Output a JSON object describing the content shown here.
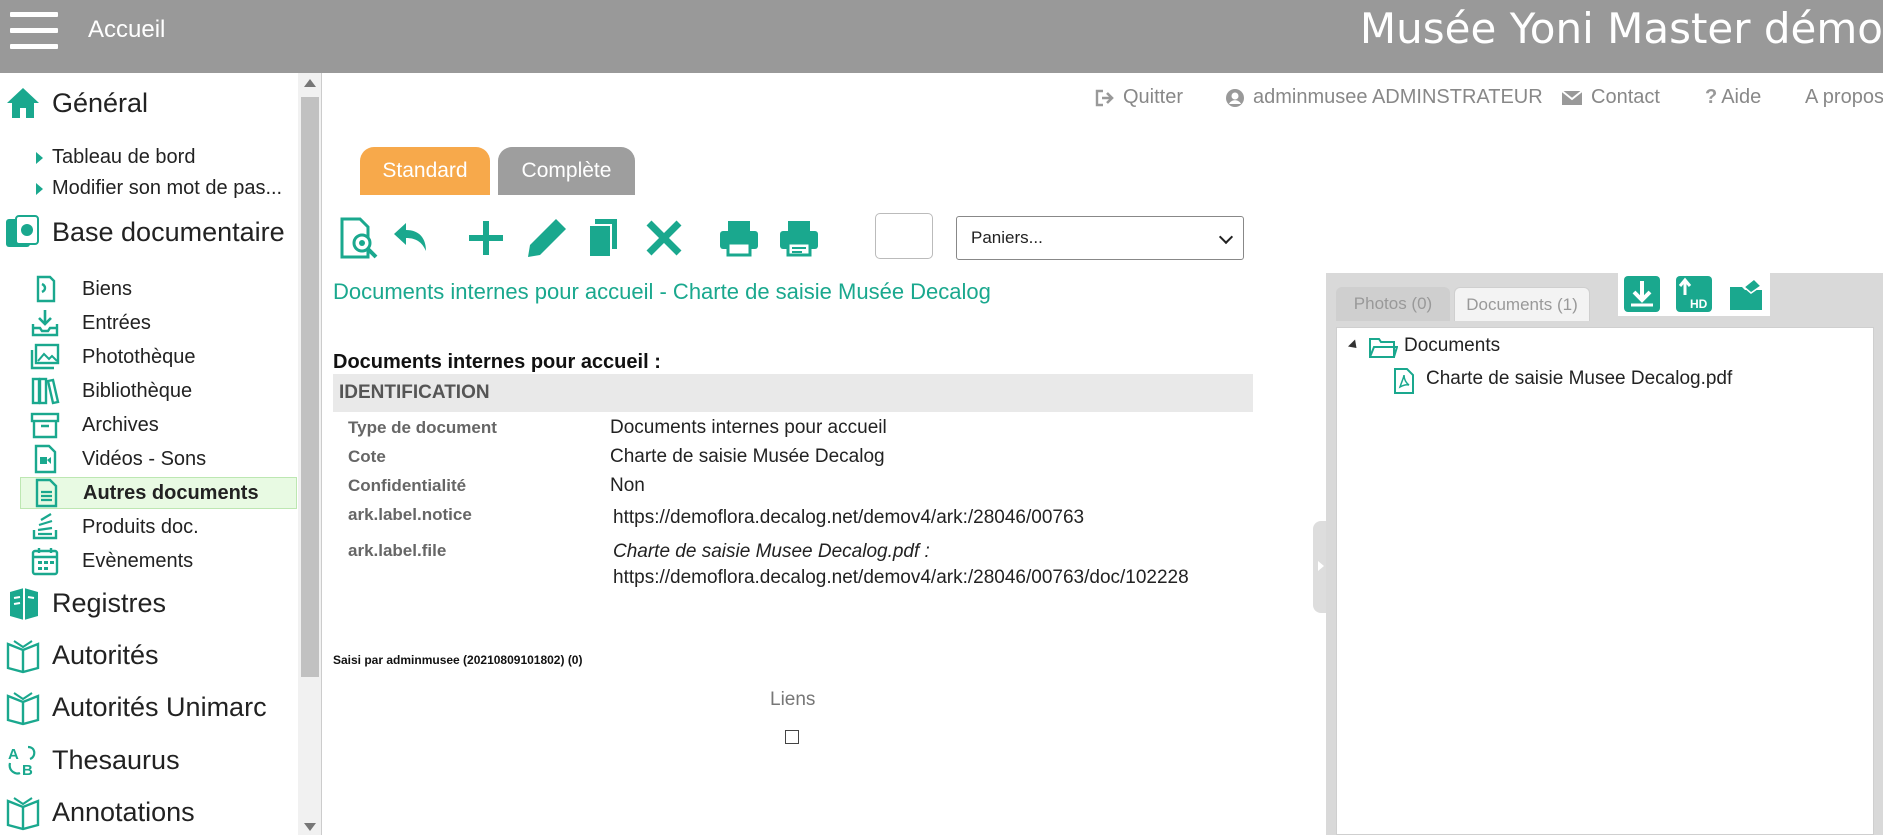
{
  "header": {
    "home_label": "Accueil",
    "site_title": "Musée Yoni Master démo"
  },
  "sidebar": {
    "general": "Général",
    "general_items": [
      "Tableau de bord",
      "Modifier son mot de pas..."
    ],
    "base_documentaire": "Base documentaire",
    "doc_items": [
      "Biens",
      "Entrées",
      "Photothèque",
      "Bibliothèque",
      "Archives",
      "Vidéos - Sons",
      "Autres documents",
      "Produits doc.",
      "Evènements"
    ],
    "active_item": "Autres documents",
    "registres": "Registres",
    "autorites": "Autorités",
    "autorites_unimarc": "Autorités Unimarc",
    "thesaurus": "Thesaurus",
    "annotations": "Annotations"
  },
  "toplinks": {
    "quitter": "Quitter",
    "user": "adminmusee ADMINSTRATEUR",
    "contact": "Contact",
    "aide": "Aide",
    "apropos": "A propos"
  },
  "tabs": {
    "standard": "Standard",
    "complete": "Complète"
  },
  "toolbar": {
    "icons": [
      "preview-search-icon",
      "undo-icon",
      "add-icon",
      "edit-icon",
      "duplicate-icon",
      "delete-icon",
      "print-icon",
      "print-alt-icon"
    ],
    "paniers_value": "Paniers..."
  },
  "record": {
    "title": "Documents internes pour accueil - Charte de saisie Musée Decalog",
    "section_heading": "Documents internes pour accueil :",
    "identification": "IDENTIFICATION",
    "fields": {
      "type_label": "Type de document",
      "type_value": "Documents internes pour accueil",
      "cote_label": "Cote",
      "cote_value": "Charte de saisie Musée Decalog",
      "conf_label": "Confidentialité",
      "conf_value": "Non",
      "notice_label": "ark.label.notice",
      "notice_value": "https://demoflora.decalog.net/demov4/ark:/28046/00763",
      "file_label": "ark.label.file",
      "file_name": "Charte de saisie Musee Decalog.pdf :",
      "file_value": "https://demoflora.decalog.net/demov4/ark:/28046/00763/doc/102228"
    },
    "saisi": "Saisi par adminmusee (20210809101802) (0)",
    "liens": "Liens"
  },
  "right_panel": {
    "tab_photos": "Photos (0)",
    "tab_documents": "Documents (1)",
    "folder": "Documents",
    "file": "Charte de saisie Musee Decalog.pdf"
  },
  "colors": {
    "accent": "#1aa88e",
    "header_bg": "#999999",
    "tab_active": "#f7a94b",
    "tab_inactive": "#9e9e9e"
  }
}
